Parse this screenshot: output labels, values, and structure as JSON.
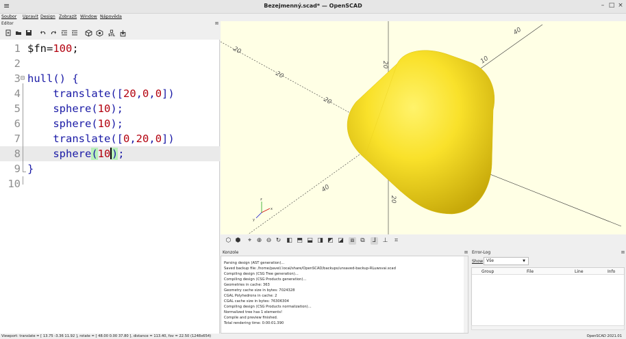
{
  "window": {
    "title": "Bezejmenný.scad* — OpenSCAD",
    "menu_icon": "≡",
    "minimize": "–",
    "maximize": "□",
    "close": "×"
  },
  "menubar": [
    "Soubor",
    "Upravit",
    "Design",
    "Zobrazit",
    "Window",
    "Nápověda"
  ],
  "editor": {
    "panel_title": "Editor",
    "close_glyph": "⊠",
    "toolbar_icons": [
      "new-file-icon",
      "open-file-icon",
      "save-icon",
      "undo-icon",
      "redo-icon",
      "indent-icon",
      "unindent-icon",
      "preview-icon",
      "render-icon",
      "export-stl-icon",
      "send-to-print-icon"
    ],
    "line_numbers": [
      "1",
      "2",
      "3",
      "4",
      "5",
      "6",
      "7",
      "8",
      "9",
      "10"
    ],
    "code": {
      "l1a": "$fn=",
      "l1b": "100",
      "l1c": ";",
      "l3": "hull() {",
      "l4a": "    translate([",
      "l4b": "20",
      "l4c": ",",
      "l4d": "0",
      "l4e": ",",
      "l4f": "0",
      "l4g": "])",
      "l5a": "    sphere(",
      "l5b": "10",
      "l5c": ");",
      "l6a": "    sphere(",
      "l6b": "10",
      "l6c": ");",
      "l7a": "    translate([",
      "l7b": "0",
      "l7c": ",",
      "l7d": "20",
      "l7e": ",",
      "l7f": "0",
      "l7g": "])",
      "l8a": "    sphere",
      "l8b": "(",
      "l8c": "10",
      "l8d": ")",
      "l8e": ";",
      "l9": "}"
    }
  },
  "viewport": {
    "axis_labels": [
      "20",
      "40",
      "10",
      "20",
      "20",
      "20",
      "40",
      "20"
    ],
    "model_color": "#f9e12a"
  },
  "view_toolbar_icons": [
    "preview-icon",
    "render-icon",
    "view-all-icon",
    "zoom-in-icon",
    "zoom-out-icon",
    "reset-view-icon",
    "view-right-icon",
    "view-top-icon",
    "view-bottom-icon",
    "view-left-icon",
    "view-front-icon",
    "view-back-icon",
    "perspective-icon",
    "orthogonal-icon",
    "show-axes-icon",
    "show-scale-icon",
    "show-edges-icon"
  ],
  "console": {
    "title": "Konzole",
    "close_glyph": "⊠",
    "messages": [
      "Parsing design (AST generation)...",
      "Saved backup file: /home/pavel/.local/share/OpenSCAD/backups/unsaved-backup-RLuwsvai.scad",
      "Compiling design (CSG Tree generation)...",
      "Compiling design (CSG Products generation)...",
      "Geometries in cache: 363",
      "Geometry cache size in bytes: 7024328",
      "CGAL Polyhedrons in cache: 2",
      "CGAL cache size in bytes: 76306304",
      "Compiling design (CSG Products normalization)...",
      "Normalized tree has 1 elements!",
      "Compile and preview finished.",
      "Total rendering time: 0:00:01.390"
    ]
  },
  "errorlog": {
    "title": "Error-Log",
    "close_glyph": "⊠",
    "show_label": "Show",
    "show_value": "Vše",
    "columns": [
      "Group",
      "File",
      "Line",
      "Info"
    ]
  },
  "statusbar": {
    "viewport": "Viewport: translate = [ 13.75 -3.36 11.92 ], rotate = [ 48.00 0.00 37.80 ], distance = 113.40, fov = 22.50 (1248x654)",
    "version": "OpenSCAD 2021.01"
  }
}
